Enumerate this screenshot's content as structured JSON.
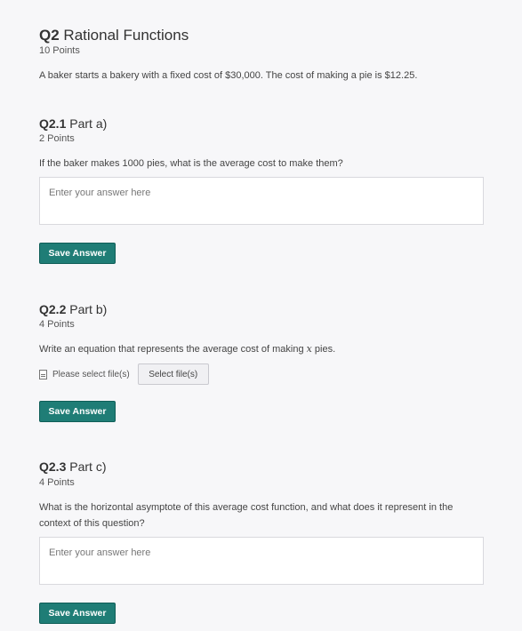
{
  "q2": {
    "number": "Q2",
    "title": "Rational Functions",
    "points": "10 Points",
    "description": "A baker starts a bakery with a fixed cost of $30,000.  The cost of making a pie is $12.25."
  },
  "q21": {
    "number": "Q2.1",
    "title": "Part a)",
    "points": "2 Points",
    "prompt": "If the baker makes 1000 pies, what is the average cost to make them?",
    "placeholder": "Enter your answer here",
    "save_label": "Save Answer"
  },
  "q22": {
    "number": "Q2.2",
    "title": "Part b)",
    "points": "4 Points",
    "prompt_before": "Write an equation that represents the average cost of making ",
    "prompt_var": "x",
    "prompt_after": " pies.",
    "file_label": "Please select file(s)",
    "file_button": "Select file(s)",
    "save_label": "Save Answer"
  },
  "q23": {
    "number": "Q2.3",
    "title": "Part c)",
    "points": "4 Points",
    "prompt": "What is the horizontal asymptote of this average cost function, and what does it represent in the context of this question?",
    "placeholder": "Enter your answer here",
    "save_label": "Save Answer"
  }
}
